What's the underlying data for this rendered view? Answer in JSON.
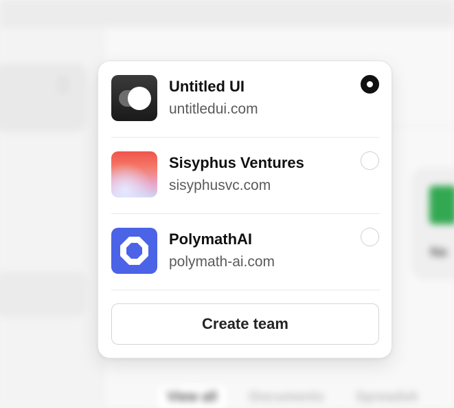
{
  "teams": [
    {
      "name": "Untitled UI",
      "domain": "untitledui.com",
      "selected": true,
      "logo_icon": "toggle-logo-icon"
    },
    {
      "name": "Sisyphus Ventures",
      "domain": "sisyphusvc.com",
      "selected": false,
      "logo_icon": "gradient-logo-icon"
    },
    {
      "name": "PolymathAI",
      "domain": "polymath-ai.com",
      "selected": false,
      "logo_icon": "octagon-logo-icon"
    }
  ],
  "create_team_label": "Create team",
  "background": {
    "tabs": [
      "View all",
      "Documents",
      "Spreadsh"
    ],
    "file_name": "Ne"
  },
  "colors": {
    "selected_radio": "#111111",
    "polymath_brand": "#4b63e6",
    "spreadsheet_green": "#33a852"
  }
}
